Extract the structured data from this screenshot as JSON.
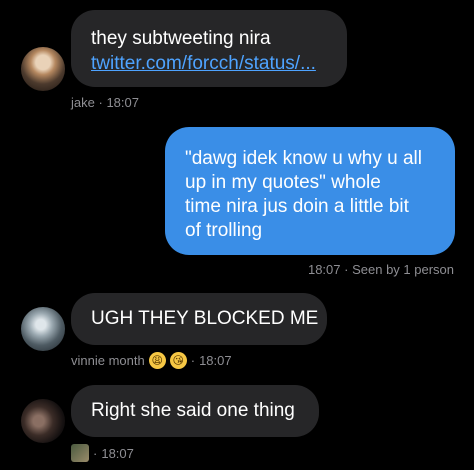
{
  "messages": [
    {
      "text": "they subtweeting nira",
      "link": "twitter.com/forcch/status/...",
      "sender": "jake",
      "time": "18:07"
    },
    {
      "lines": [
        "\"dawg idek know u why u all",
        "up in my quotes\" whole",
        "time nira jus doin a little bit",
        "of trolling"
      ],
      "time": "18:07",
      "status": "Seen by 1 person"
    },
    {
      "text": "UGH THEY BLOCKED ME",
      "sender": "vinnie month",
      "time": "18:07",
      "emojis": [
        "😩",
        "😘"
      ]
    },
    {
      "text": "Right she said one thing",
      "time": "18:07"
    }
  ]
}
